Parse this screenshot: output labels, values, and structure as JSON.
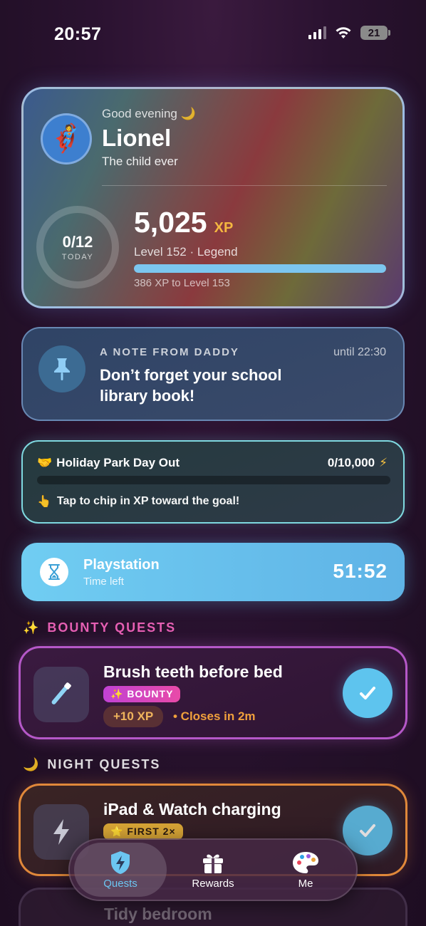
{
  "status": {
    "time": "20:57",
    "battery": "21"
  },
  "profile": {
    "greeting": "Good evening 🌙",
    "name": "Lionel",
    "tagline": "The child ever",
    "today_count": "0/12",
    "today_label": "TODAY",
    "xp": "5,025",
    "xp_unit": "XP",
    "level": "Level 152 · Legend",
    "level_progress": 1.0,
    "next_level": "386 XP to Level 153"
  },
  "note": {
    "title": "A NOTE FROM DADDY",
    "until": "until 22:30",
    "text": "Don’t forget your school library book!"
  },
  "goal": {
    "emoji": "🤝",
    "title": "Holiday Park Day Out",
    "count": "0/10,000",
    "count_icon": "⚡",
    "hint_icon": "👆",
    "hint": "Tap to chip in XP toward the goal!"
  },
  "timer": {
    "name": "Playstation",
    "sub": "Time left",
    "value": "51:52"
  },
  "sections": {
    "bounty_icon": "✨",
    "bounty": "BOUNTY QUESTS",
    "night_icon": "🌙",
    "night": "NIGHT QUESTS"
  },
  "quests": {
    "bounty": {
      "title": "Brush teeth before bed",
      "badge": "✨ BOUNTY",
      "xp": "+10 XP",
      "closes": "• Closes in 2m"
    },
    "night": {
      "title": "iPad & Watch charging",
      "badge": "⭐ FIRST 2×"
    },
    "next": {
      "title": "Tidy bedroom"
    }
  },
  "tabs": [
    {
      "label": "Quests",
      "icon": "lightning-shield-icon"
    },
    {
      "label": "Rewards",
      "icon": "gift-icon"
    },
    {
      "label": "Me",
      "icon": "palette-icon"
    }
  ],
  "colors": {
    "accent": "#6cc6f2",
    "bounty": "#e65fb3",
    "xp": "#f4b740"
  }
}
